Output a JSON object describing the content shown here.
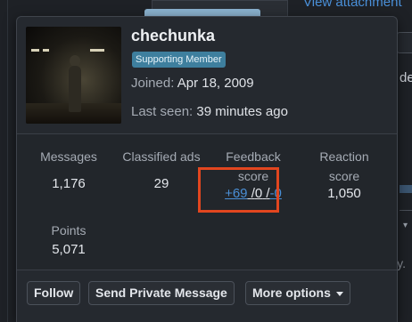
{
  "background": {
    "link": "View attachment",
    "partial_text": "de",
    "partial_text_2": "ly.",
    "username": "chechunka"
  },
  "card": {
    "username": "chechunka",
    "badge": "Supporting Member",
    "joined_label": "Joined:",
    "joined_value": "Apr 18, 2009",
    "seen_label": "Last seen:",
    "seen_value": "39 minutes ago",
    "avatar": "user-avatar"
  },
  "stats": {
    "messages": {
      "label": "Messages",
      "value": "1,176"
    },
    "classified": {
      "label": "Classified ads",
      "value": "29"
    },
    "feedback": {
      "label_1": "Feedback",
      "label_2": "score",
      "positive": "+69",
      "neutral": "0",
      "negative": "-0",
      "separator": "/"
    },
    "reaction": {
      "label_1": "Reaction",
      "label_2": "score",
      "value": "1,050"
    },
    "points": {
      "label": "Points",
      "value": "5,071"
    }
  },
  "actions": {
    "follow": "Follow",
    "private_message": "Send Private Message",
    "more_options": "More options"
  },
  "colors": {
    "background": "#1e2126",
    "card": "#25292f",
    "badge": "#3e7f9e",
    "link": "#4a8fd6",
    "highlight": "#e2461f"
  }
}
